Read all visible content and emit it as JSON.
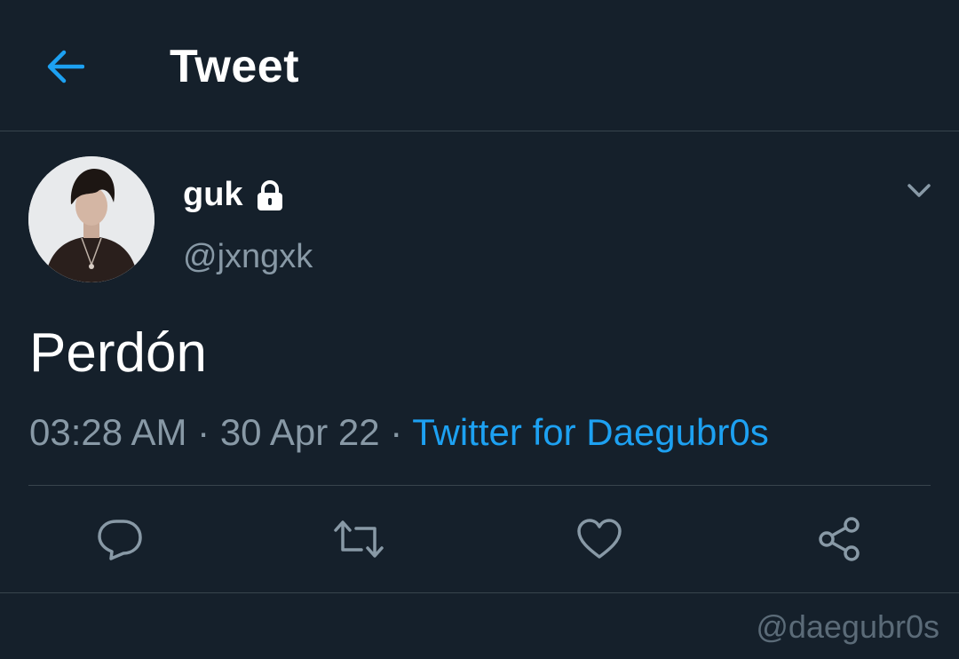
{
  "header": {
    "title": "Tweet",
    "back_icon": "arrow-left-icon"
  },
  "author": {
    "display_name": "guk",
    "handle": "@jxngxk",
    "protected_icon": "lock-icon",
    "menu_icon": "chevron-down-icon"
  },
  "tweet": {
    "text": "Perdón",
    "time": "03:28 AM",
    "separator": "·",
    "date": "30 Apr 22",
    "source": "Twitter for Daegubr0s"
  },
  "actions": [
    {
      "name": "reply",
      "icon": "reply-icon"
    },
    {
      "name": "retweet",
      "icon": "retweet-icon"
    },
    {
      "name": "like",
      "icon": "heart-icon"
    },
    {
      "name": "share",
      "icon": "share-icon"
    }
  ],
  "watermark": "@daegubr0s",
  "colors": {
    "background": "#15202b",
    "accent": "#1da1f2",
    "secondary_text": "#8899a6",
    "divider": "#38444d"
  }
}
